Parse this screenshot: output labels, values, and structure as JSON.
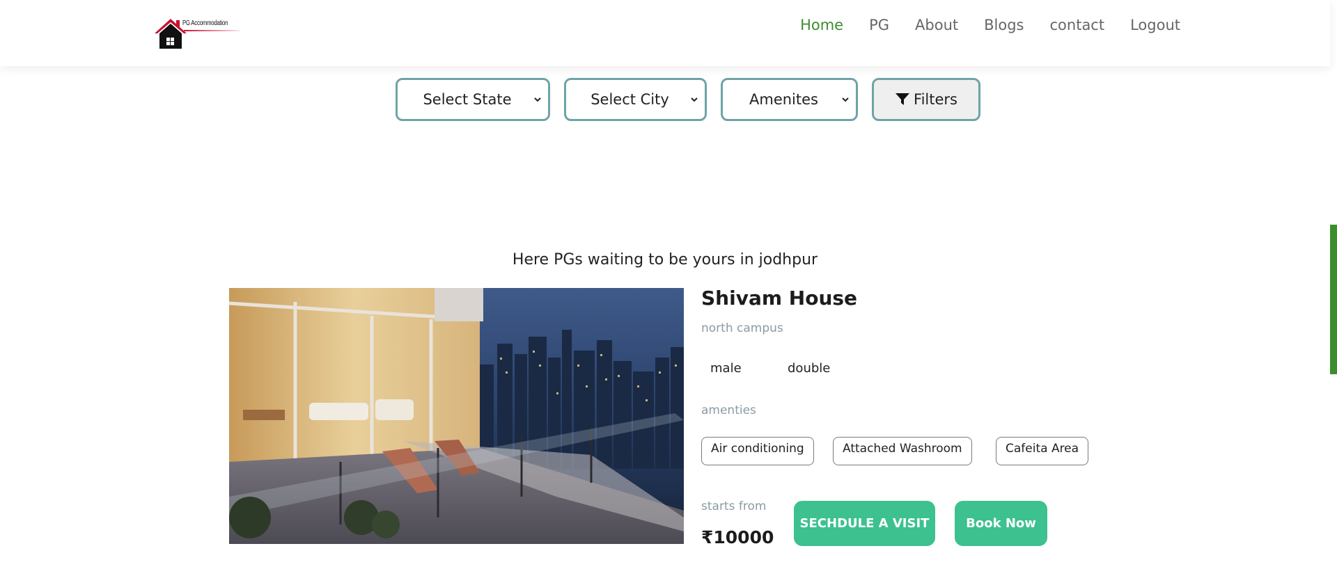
{
  "brand": {
    "logo_text": "PG Accommodation"
  },
  "nav": {
    "items": [
      {
        "label": "Home",
        "active": true
      },
      {
        "label": "PG"
      },
      {
        "label": "About"
      },
      {
        "label": "Blogs"
      },
      {
        "label": "contact"
      },
      {
        "label": "Logout"
      }
    ]
  },
  "filters": {
    "state_label": "Select State",
    "city_label": "Select City",
    "amenities_label": "Amenites",
    "filters_button": "Filters"
  },
  "headline": "Here PGs waiting to be yours in jodhpur",
  "listing": {
    "name": "Shivam House",
    "location": "north campus",
    "gender": "male",
    "sharing": "double",
    "amenities_title": "amenties",
    "amenities": [
      "Air conditioning",
      "Attached Washroom",
      "Cafeita Area"
    ],
    "starts_from_label": "starts from",
    "price": "₹10000",
    "visit_button": "SECHDULE A VISIT",
    "book_button": "Book Now"
  },
  "colors": {
    "accent_green": "#3a8f2c",
    "button_green": "#3cc18f",
    "select_border": "#6fa3a6"
  }
}
